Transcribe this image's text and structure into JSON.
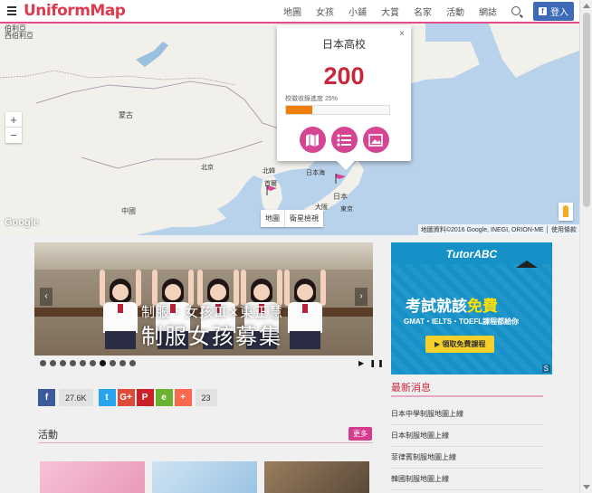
{
  "header": {
    "logo": "UniformMap",
    "nav": [
      "地圖",
      "女孩",
      "小鋪",
      "大賞",
      "名家",
      "活動",
      "網誌"
    ],
    "login_label": "登入",
    "fb_glyph": "f"
  },
  "map": {
    "labels": {
      "top_left_1": "伯利亞",
      "top_left_2": "西伯利亞",
      "mongolia": "蒙古",
      "china": "中國",
      "beijing": "北京",
      "north_korea": "北韓",
      "seoul": "首爾",
      "japan_sea": "日本海",
      "japan": "日本",
      "osaka": "大阪",
      "tokyo": "東京"
    },
    "zoom_in": "+",
    "zoom_out": "−",
    "map_type": [
      "地圖",
      "衛星檢視"
    ],
    "google": "Google",
    "credit": "地圖資料©2016 Google, INEGI, ORION-ME │ 使用條款"
  },
  "infowindow": {
    "close": "×",
    "title": "日本高校",
    "count": "200",
    "rate_label": "校徽收錄進度 25%",
    "rate_value": 0.25,
    "icons": [
      "map-icon",
      "list-icon",
      "photo-icon"
    ]
  },
  "banner": {
    "text1": "制服・女孩Ⅲ×東正慧",
    "text2": "制服女孩募集",
    "prev": "‹",
    "next": "›",
    "dots": 10,
    "active_dot": 6,
    "controls": "▶ ❚❚"
  },
  "share": {
    "facebook": "f",
    "facebook_count": "27.6K",
    "twitter": "t",
    "google_plus": "G+",
    "pinterest": "P",
    "evernote": "e",
    "addthis": "+",
    "total_count": "23"
  },
  "activities": {
    "title": "活動",
    "more": "更多"
  },
  "ad": {
    "logo": "TutorABC",
    "headline_a": "考試就該",
    "headline_b": "免費",
    "subline": "GMAT・IELTS・TOEFL課程都給你",
    "cta": "▶ 領取免費課程",
    "badge": "S"
  },
  "news": {
    "title": "最新消息",
    "items": [
      "日本中學制服地圖上線",
      "日本制服地圖上線",
      "菲律賓制服地圖上線",
      "韓國制服地圖上線"
    ]
  },
  "colors": {
    "accent": "#d64592",
    "brand_red": "#e03a4f",
    "progress": "#f07f0a",
    "ocean": "#b9d2ec",
    "land": "#f2f0ea"
  }
}
